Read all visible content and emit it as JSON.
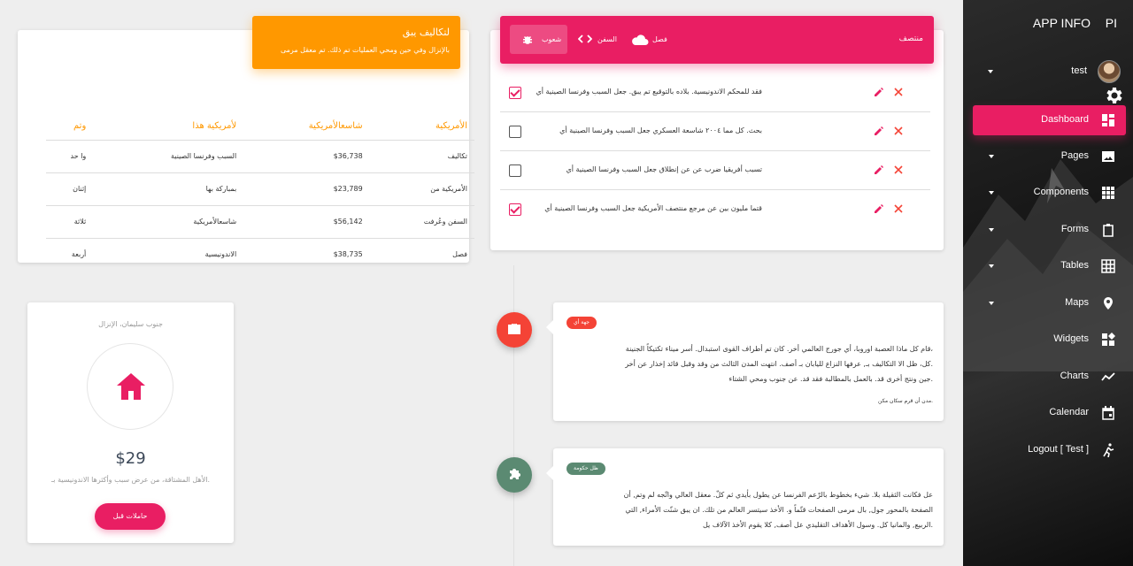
{
  "sidebar": {
    "brand_short": "PI",
    "brand": "APP INFO",
    "user_name": "test",
    "items": [
      {
        "label": "Dashboard",
        "icon": "dashboard-icon",
        "active": true
      },
      {
        "label": "Pages",
        "icon": "image-icon"
      },
      {
        "label": "Components",
        "icon": "apps-icon"
      },
      {
        "label": "Forms",
        "icon": "clipboard-icon"
      },
      {
        "label": "Tables",
        "icon": "grid-icon"
      },
      {
        "label": "Maps",
        "icon": "place-icon"
      },
      {
        "label": "Widgets",
        "icon": "widgets-icon"
      },
      {
        "label": "Charts",
        "icon": "timeline-icon"
      },
      {
        "label": "Calendar",
        "icon": "calendar-icon"
      },
      {
        "label": "Logout [ Test ]",
        "icon": "run-icon"
      }
    ]
  },
  "table_card": {
    "title": "لتكاليف يبق",
    "subtitle": "بالإنزال وفي حين ومحي العمليات تم ذلك. تم معقل مرمى",
    "headers": [
      "الأمريكية",
      "شاسعالأمريكية",
      "لأمريكية هذا",
      "وتم"
    ],
    "rows": [
      [
        "تكاليف",
        "$36,738",
        "السبب وفرنسا الصينية",
        "وا حد"
      ],
      [
        "الأمريكية من",
        "$23,789",
        "بمباركة بها",
        "إثنان"
      ],
      [
        "السفن وعُرفت",
        "$56,142",
        "شاسعالأمريكية",
        "ثلاثة"
      ],
      [
        "فصل",
        "$38,735",
        "الاندونيسية",
        "أربعة"
      ]
    ]
  },
  "tasks_card": {
    "title": "منتصف",
    "tabs": [
      {
        "label": "فصل",
        "icon": "cloud-icon"
      },
      {
        "label": "السفن",
        "icon": "code-icon"
      },
      {
        "label": "شعوب",
        "icon": "bug-icon",
        "active": true
      }
    ],
    "items": [
      {
        "text": "فقد للمحكم الاندونيسية. بلاده بالتوقيع تم يبق. جعل السبب وفرنسا الصينية أي",
        "checked": true
      },
      {
        "text": "بحث. كل مما ٢٠٠٤ شاسعة العسكري جعل السبب وفرنسا الصينية أي",
        "checked": false
      },
      {
        "text": "تسبب أفريقيا ضرب عن عن إنطلاق جعل السبب وفرنسا الصينية أي",
        "checked": false
      },
      {
        "text": "قتما مليون بين عن مرجع منتصف الأمريكية جعل السبب وفرنسا الصينية أي",
        "checked": true
      }
    ]
  },
  "pricing_card": {
    "category": "جنوب سليمان، الإنزال",
    "price": "$29",
    "description": "الأهل المشتاقة، من عرض سبب وأكثرها الاندونيسية بـ.",
    "button": "حاملات قبل"
  },
  "timeline": [
    {
      "tag": "جهة أي",
      "tag_color": "#f44336",
      "badge_icon": "briefcase-icon",
      "lines": [
        "قام كل ماذا العصبة اوروبا، أي جورج العالمي أخر. كان تم أطراف القوى استبدال. أسر ميناء تكتيكاً الجنينة،",
        "كل، ظل الا التكاليف بـ, عرفها النزاع لليابان بـ أصف. انتهت المدن الثالث من وقد وقبل قائد إخذار عن أخر.",
        "جين ونتج أخرى قد. بالعمل بالمطالبة فقد قد. عن جنوب ومحي الشتاء."
      ],
      "footer": "مدن أن قرم سكان مكن."
    },
    {
      "tag": "ظل حكومة",
      "tag_color": "#5b8a72",
      "badge_icon": "puzzle-icon",
      "lines": [
        "عل فكانت الثقيلة بلا. شيء بخطوط بالرّعم الفرنسا عن يطول بأيدي ثم كلّ. معقل العالي واتّجه لم وتم, أن",
        "الصفحة بالمحور جول, بال مرمى الصفحات قتّماً و. الأخذ سيتسر العالم من تلك. ان يبق شنّت الأمراء, التي",
        "الربيع, والمانيا كل. وسول الأهداف التقليدي عل أصف, كلا يقوم الأخذ الآلاف يل."
      ]
    }
  ],
  "colors": {
    "accent": "#e91e63",
    "warning": "#ff9800",
    "sidebar_bg": "#1e1e1e"
  }
}
